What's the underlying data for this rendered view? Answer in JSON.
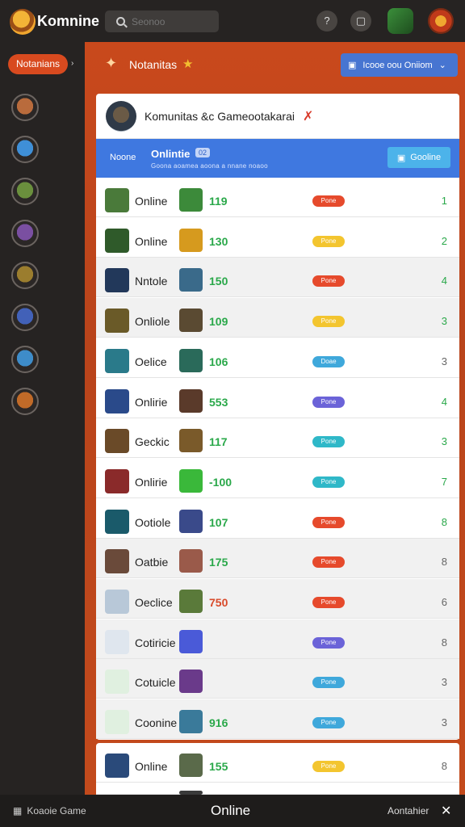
{
  "header": {
    "brand": "Komnine",
    "search_placeholder": "Seonoo"
  },
  "sidebar": {
    "notif_label": "Notanians",
    "avatars": [
      "#b96b3c",
      "#3f8fd7",
      "#6a8f3d",
      "#7a4fa1",
      "#9b7d2e",
      "#4261b8",
      "#3e8cc9",
      "#c06a28"
    ]
  },
  "section": {
    "title": "Notanitas",
    "button_label": "Icooe oou Oniiom"
  },
  "card": {
    "title": "Komunitas &c Gameootakarai",
    "bar": {
      "name": "Noone",
      "online": "Onlintie",
      "badge": "02",
      "subtitle": "Goona aoamea aoona a nnane noaoo",
      "button_label": "Gooline"
    }
  },
  "rows": [
    {
      "name": "Online",
      "num": "119",
      "num_color": "#2aa84a",
      "pill_color": "#e64a2c",
      "pill": "Pone",
      "count": "1",
      "count_color": "#2aa84a",
      "icon_color": "#4a7a3a",
      "game_color": "#3c8a3a",
      "alt": false
    },
    {
      "name": "Online",
      "num": "130",
      "num_color": "#2aa84a",
      "pill_color": "#f3c52f",
      "pill": "Pone",
      "count": "2",
      "count_color": "#2aa84a",
      "icon_color": "#2f5a2a",
      "game_color": "#d69a1e",
      "alt": false
    },
    {
      "name": "Nntole",
      "num": "150",
      "num_color": "#2aa84a",
      "pill_color": "#e64a2c",
      "pill": "Pone",
      "count": "4",
      "count_color": "#2aa84a",
      "icon_color": "#22385a",
      "game_color": "#3a6a8a",
      "alt": true
    },
    {
      "name": "Onliole",
      "num": "109",
      "num_color": "#2aa84a",
      "pill_color": "#f3c52f",
      "pill": "Pone",
      "count": "3",
      "count_color": "#2aa84a",
      "icon_color": "#6a5a28",
      "game_color": "#5a4a32",
      "alt": true
    },
    {
      "name": "Oelice",
      "num": "106",
      "num_color": "#2aa84a",
      "pill_color": "#3fa8db",
      "pill": "Doae",
      "count": "3",
      "count_color": "#666",
      "icon_color": "#2a7a8a",
      "game_color": "#2a6a5a",
      "alt": false
    },
    {
      "name": "Onlirie",
      "num": "553",
      "num_color": "#2aa84a",
      "pill_color": "#6b63d8",
      "pill": "Pone",
      "count": "4",
      "count_color": "#2aa84a",
      "icon_color": "#2a4a8a",
      "game_color": "#5a3a2a",
      "alt": false
    },
    {
      "name": "Geckic",
      "num": "117",
      "num_color": "#2aa84a",
      "pill_color": "#2fb8c8",
      "pill": "Pone",
      "count": "3",
      "count_color": "#2aa84a",
      "icon_color": "#6a4a28",
      "game_color": "#7a5a2a",
      "alt": false
    },
    {
      "name": "Onlirie",
      "num": "-100",
      "num_color": "#2aa84a",
      "pill_color": "#2fb8c8",
      "pill": "Pone",
      "count": "7",
      "count_color": "#2aa84a",
      "icon_color": "#8a2a2a",
      "game_color": "#3ab83a",
      "alt": false
    },
    {
      "name": "Ootiole",
      "num": "107",
      "num_color": "#2aa84a",
      "pill_color": "#e64a2c",
      "pill": "Pone",
      "count": "8",
      "count_color": "#2aa84a",
      "icon_color": "#1a5a6a",
      "game_color": "#3a4a8a",
      "alt": false
    },
    {
      "name": "Oatbie",
      "num": "175",
      "num_color": "#2aa84a",
      "pill_color": "#e64a2c",
      "pill": "Pone",
      "count": "8",
      "count_color": "#666",
      "icon_color": "#6a4a3a",
      "game_color": "#9a5a4a",
      "alt": true
    },
    {
      "name": "Oeclice",
      "num": "750",
      "num_color": "#d84a2a",
      "pill_color": "#e64a2c",
      "pill": "Pone",
      "count": "6",
      "count_color": "#666",
      "icon_color": "#b8c8d8",
      "game_color": "#5a7a3a",
      "alt": true
    },
    {
      "name": "Cotiricie",
      "num": "",
      "num_color": "#2aa84a",
      "pill_color": "#6b63d8",
      "pill": "Pone",
      "count": "8",
      "count_color": "#666",
      "icon_color": "#dfe6ee",
      "game_color": "#4a5ad8",
      "alt": true
    },
    {
      "name": "Cotuicle",
      "num": "",
      "num_color": "#2aa84a",
      "pill_color": "#3fa8db",
      "pill": "Pone",
      "count": "3",
      "count_color": "#666",
      "icon_color": "#e0f0e0",
      "game_color": "#6a3a8a",
      "alt": true
    },
    {
      "name": "Coonine",
      "num": "916",
      "num_color": "#2aa84a",
      "pill_color": "#3fa8db",
      "pill": "Pone",
      "count": "3",
      "count_color": "#666",
      "icon_color": "#e0f0e0",
      "game_color": "#3a7a9a",
      "alt": true
    }
  ],
  "extra_row": {
    "name": "Online",
    "num": "155",
    "num_color": "#2aa84a",
    "pill_color": "#f3c52f",
    "pill": "Pone",
    "count": "8",
    "count_color": "#666",
    "icon_color": "#2a4a7a",
    "game_color": "#5a6a4a"
  },
  "bottom": {
    "left_label": "Koaoie Game",
    "center_label": "Online",
    "right_label": "Aontahier"
  }
}
